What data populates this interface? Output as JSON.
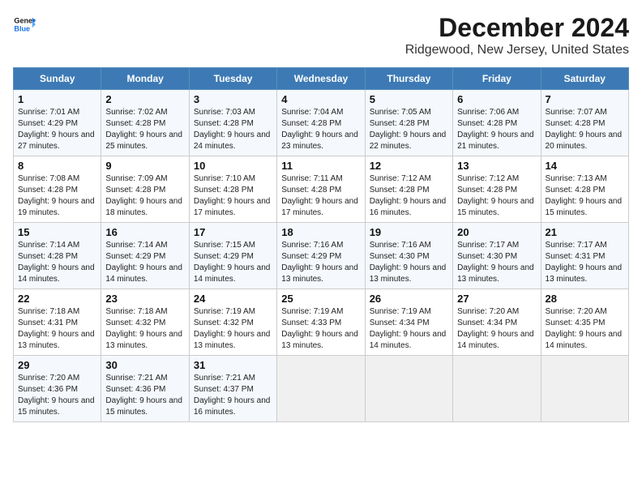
{
  "header": {
    "logo_line1": "General",
    "logo_line2": "Blue",
    "main_title": "December 2024",
    "subtitle": "Ridgewood, New Jersey, United States"
  },
  "days_of_week": [
    "Sunday",
    "Monday",
    "Tuesday",
    "Wednesday",
    "Thursday",
    "Friday",
    "Saturday"
  ],
  "weeks": [
    [
      {
        "day": "1",
        "sunrise": "7:01 AM",
        "sunset": "4:29 PM",
        "daylight": "9 hours and 27 minutes."
      },
      {
        "day": "2",
        "sunrise": "7:02 AM",
        "sunset": "4:28 PM",
        "daylight": "9 hours and 25 minutes."
      },
      {
        "day": "3",
        "sunrise": "7:03 AM",
        "sunset": "4:28 PM",
        "daylight": "9 hours and 24 minutes."
      },
      {
        "day": "4",
        "sunrise": "7:04 AM",
        "sunset": "4:28 PM",
        "daylight": "9 hours and 23 minutes."
      },
      {
        "day": "5",
        "sunrise": "7:05 AM",
        "sunset": "4:28 PM",
        "daylight": "9 hours and 22 minutes."
      },
      {
        "day": "6",
        "sunrise": "7:06 AM",
        "sunset": "4:28 PM",
        "daylight": "9 hours and 21 minutes."
      },
      {
        "day": "7",
        "sunrise": "7:07 AM",
        "sunset": "4:28 PM",
        "daylight": "9 hours and 20 minutes."
      }
    ],
    [
      {
        "day": "8",
        "sunrise": "7:08 AM",
        "sunset": "4:28 PM",
        "daylight": "9 hours and 19 minutes."
      },
      {
        "day": "9",
        "sunrise": "7:09 AM",
        "sunset": "4:28 PM",
        "daylight": "9 hours and 18 minutes."
      },
      {
        "day": "10",
        "sunrise": "7:10 AM",
        "sunset": "4:28 PM",
        "daylight": "9 hours and 17 minutes."
      },
      {
        "day": "11",
        "sunrise": "7:11 AM",
        "sunset": "4:28 PM",
        "daylight": "9 hours and 17 minutes."
      },
      {
        "day": "12",
        "sunrise": "7:12 AM",
        "sunset": "4:28 PM",
        "daylight": "9 hours and 16 minutes."
      },
      {
        "day": "13",
        "sunrise": "7:12 AM",
        "sunset": "4:28 PM",
        "daylight": "9 hours and 15 minutes."
      },
      {
        "day": "14",
        "sunrise": "7:13 AM",
        "sunset": "4:28 PM",
        "daylight": "9 hours and 15 minutes."
      }
    ],
    [
      {
        "day": "15",
        "sunrise": "7:14 AM",
        "sunset": "4:28 PM",
        "daylight": "9 hours and 14 minutes."
      },
      {
        "day": "16",
        "sunrise": "7:14 AM",
        "sunset": "4:29 PM",
        "daylight": "9 hours and 14 minutes."
      },
      {
        "day": "17",
        "sunrise": "7:15 AM",
        "sunset": "4:29 PM",
        "daylight": "9 hours and 14 minutes."
      },
      {
        "day": "18",
        "sunrise": "7:16 AM",
        "sunset": "4:29 PM",
        "daylight": "9 hours and 13 minutes."
      },
      {
        "day": "19",
        "sunrise": "7:16 AM",
        "sunset": "4:30 PM",
        "daylight": "9 hours and 13 minutes."
      },
      {
        "day": "20",
        "sunrise": "7:17 AM",
        "sunset": "4:30 PM",
        "daylight": "9 hours and 13 minutes."
      },
      {
        "day": "21",
        "sunrise": "7:17 AM",
        "sunset": "4:31 PM",
        "daylight": "9 hours and 13 minutes."
      }
    ],
    [
      {
        "day": "22",
        "sunrise": "7:18 AM",
        "sunset": "4:31 PM",
        "daylight": "9 hours and 13 minutes."
      },
      {
        "day": "23",
        "sunrise": "7:18 AM",
        "sunset": "4:32 PM",
        "daylight": "9 hours and 13 minutes."
      },
      {
        "day": "24",
        "sunrise": "7:19 AM",
        "sunset": "4:32 PM",
        "daylight": "9 hours and 13 minutes."
      },
      {
        "day": "25",
        "sunrise": "7:19 AM",
        "sunset": "4:33 PM",
        "daylight": "9 hours and 13 minutes."
      },
      {
        "day": "26",
        "sunrise": "7:19 AM",
        "sunset": "4:34 PM",
        "daylight": "9 hours and 14 minutes."
      },
      {
        "day": "27",
        "sunrise": "7:20 AM",
        "sunset": "4:34 PM",
        "daylight": "9 hours and 14 minutes."
      },
      {
        "day": "28",
        "sunrise": "7:20 AM",
        "sunset": "4:35 PM",
        "daylight": "9 hours and 14 minutes."
      }
    ],
    [
      {
        "day": "29",
        "sunrise": "7:20 AM",
        "sunset": "4:36 PM",
        "daylight": "9 hours and 15 minutes."
      },
      {
        "day": "30",
        "sunrise": "7:21 AM",
        "sunset": "4:36 PM",
        "daylight": "9 hours and 15 minutes."
      },
      {
        "day": "31",
        "sunrise": "7:21 AM",
        "sunset": "4:37 PM",
        "daylight": "9 hours and 16 minutes."
      },
      null,
      null,
      null,
      null
    ]
  ],
  "labels": {
    "sunrise": "Sunrise:",
    "sunset": "Sunset:",
    "daylight": "Daylight:"
  }
}
